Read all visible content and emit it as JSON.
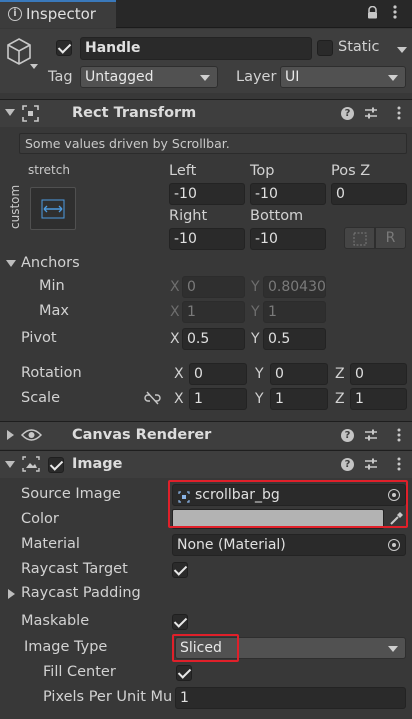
{
  "tab": {
    "title": "Inspector"
  },
  "header": {
    "name": "Handle",
    "static_label": "Static",
    "tag_label": "Tag",
    "tag_value": "Untagged",
    "layer_label": "Layer",
    "layer_value": "UI"
  },
  "rect_transform": {
    "title": "Rect Transform",
    "driven_note": "Some values driven by Scrollbar.",
    "anchor_top_label": "stretch",
    "anchor_side_label": "custom",
    "left_label": "Left",
    "left_value": "-10",
    "top_label": "Top",
    "top_value": "-10",
    "posz_label": "Pos Z",
    "posz_value": "0",
    "right_label": "Right",
    "right_value": "-10",
    "bottom_label": "Bottom",
    "bottom_value": "-10",
    "raw_button": "R",
    "anchors_label": "Anchors",
    "min_label": "Min",
    "min_x": "0",
    "min_y": "0.80430",
    "max_label": "Max",
    "max_x": "1",
    "max_y": "1",
    "pivot_label": "Pivot",
    "pivot_x": "0.5",
    "pivot_y": "0.5",
    "rotation_label": "Rotation",
    "rot_x": "0",
    "rot_y": "0",
    "rot_z": "0",
    "scale_label": "Scale",
    "scale_x": "1",
    "scale_y": "1",
    "scale_z": "1",
    "axis_x": "X",
    "axis_y": "Y",
    "axis_z": "Z"
  },
  "canvas_renderer": {
    "title": "Canvas Renderer"
  },
  "image": {
    "title": "Image",
    "source_image_label": "Source Image",
    "source_image_value": "scrollbar_bg",
    "color_label": "Color",
    "color_value": "#b3b3b3",
    "material_label": "Material",
    "material_value": "None (Material)",
    "raycast_target_label": "Raycast Target",
    "raycast_padding_label": "Raycast Padding",
    "maskable_label": "Maskable",
    "image_type_label": "Image Type",
    "image_type_value": "Sliced",
    "fill_center_label": "Fill Center",
    "ppu_label": "Pixels Per Unit Mu",
    "ppu_value": "1"
  },
  "colors": {
    "highlight": "#e0202a",
    "background": "#383838"
  }
}
